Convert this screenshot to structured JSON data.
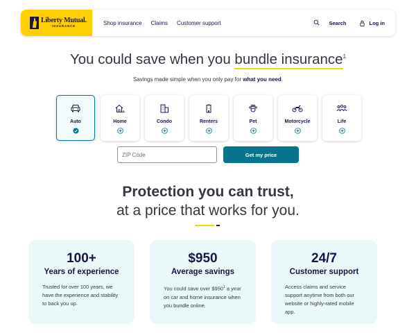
{
  "header": {
    "logo": {
      "name": "Liberty Mutual.",
      "sub": "INSURANCE"
    },
    "nav": [
      "Shop insurance",
      "Claims",
      "Customer support"
    ],
    "search_label": "Search",
    "login_label": "Log in"
  },
  "hero": {
    "title_pre": "You could save when you ",
    "title_highlight": "bundle insurance",
    "title_sup": "1",
    "sub_pre": "Savings made simple when you only pay for ",
    "sub_bold": "what you need",
    "sub_post": "."
  },
  "products": [
    {
      "label": "Auto",
      "icon": "car-icon",
      "selected": true
    },
    {
      "label": "Home",
      "icon": "house-icon",
      "selected": false
    },
    {
      "label": "Condo",
      "icon": "building-icon",
      "selected": false
    },
    {
      "label": "Renters",
      "icon": "apartment-icon",
      "selected": false
    },
    {
      "label": "Pet",
      "icon": "paw-icon",
      "selected": false
    },
    {
      "label": "Motorcycle",
      "icon": "motorcycle-icon",
      "selected": false
    },
    {
      "label": "Life",
      "icon": "family-icon",
      "selected": false
    }
  ],
  "quote": {
    "zip_placeholder": "ZIP Code",
    "zip_value": "",
    "button_label": "Get my price"
  },
  "protection": {
    "title": "Protection you can trust,",
    "subtitle": "at a price that works for you."
  },
  "stats": [
    {
      "value": "100+",
      "title": "Years of experience",
      "desc_pre": "Trusted for over 100 years, we have the experience and stability to back you up.",
      "desc_sup": "",
      "desc_post": ""
    },
    {
      "value": "$950",
      "title": "Average savings",
      "desc_pre": "You could save over $950",
      "desc_sup": "1",
      "desc_post": " a year on car and home insurance when you bundle online."
    },
    {
      "value": "24/7",
      "title": "Customer support",
      "desc_pre": "Access claims and service support anytime from both our website or highly-rated mobile app.",
      "desc_sup": "",
      "desc_post": ""
    }
  ],
  "colors": {
    "brand_yellow": "#ffd000",
    "brand_navy": "#1a1446",
    "teal": "#06748c",
    "stat_bg": "#eaf8fa"
  }
}
